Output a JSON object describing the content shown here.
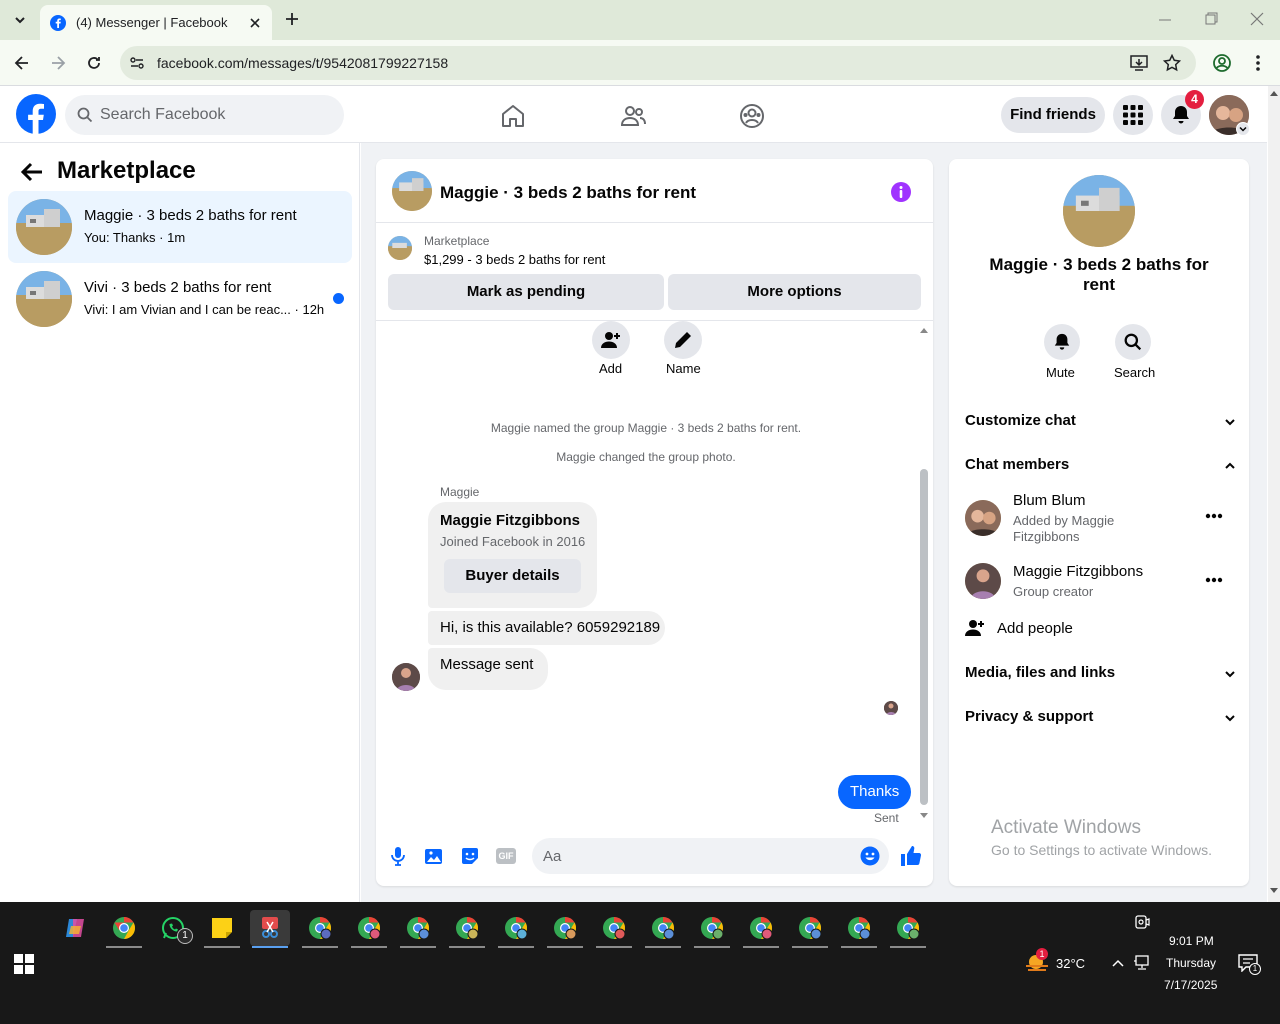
{
  "browser": {
    "tab_title": "(4) Messenger | Facebook",
    "url": "facebook.com/messages/t/9542081799227158"
  },
  "header": {
    "search_placeholder": "Search Facebook",
    "find_friends": "Find friends",
    "notif_count": "4"
  },
  "left": {
    "title": "Marketplace",
    "conversations": [
      {
        "name": "Maggie · 3 beds 2 baths for rent",
        "snippet": "You: Thanks · 1m"
      },
      {
        "name": "Vivi · 3 beds 2 baths for rent",
        "snippet": "Vivi: I am Vivian and I can be reac... · 12h"
      }
    ]
  },
  "chat": {
    "title": "Maggie · 3 beds 2 baths for rent",
    "listing_source": "Marketplace",
    "listing_info": "$1,299 - 3 beds 2 baths for rent",
    "mark_pending": "Mark as pending",
    "more_options": "More options",
    "add_label": "Add",
    "name_label": "Name",
    "sys1": "Maggie named the group Maggie · 3 beds 2 baths for rent.",
    "sys2": "Maggie changed the group photo.",
    "sender_name": "Maggie",
    "card_name": "Maggie Fitzgibbons",
    "card_sub": "Joined Facebook in 2016",
    "buyer_details": "Buyer details",
    "msg1": "Hi, is this available? 6059292189",
    "msg2": "Message sent",
    "my_msg": "Thanks",
    "sent_label": "Sent",
    "composer_placeholder": "Aa"
  },
  "right": {
    "title": "Maggie · 3 beds 2 baths for rent",
    "mute": "Mute",
    "search": "Search",
    "customize": "Customize chat",
    "members": "Chat members",
    "member1_name": "Blum Blum",
    "member1_sub": "Added by Maggie Fitzgibbons",
    "member2_name": "Maggie Fitzgibbons",
    "member2_sub": "Group creator",
    "add_people": "Add people",
    "media": "Media, files and links",
    "privacy": "Privacy & support",
    "activate_title": "Activate Windows",
    "activate_sub": "Go to Settings to activate Windows."
  },
  "taskbar": {
    "temp": "32°C",
    "time": "9:01 PM",
    "day": "Thursday",
    "date": "7/17/2025",
    "whatsapp_badge": "1",
    "weather_badge": "1",
    "action_badge": "1"
  },
  "colors": {
    "fb_blue": "#0866ff",
    "notif_red": "#e41e3f",
    "info_purple": "#a033ff"
  }
}
